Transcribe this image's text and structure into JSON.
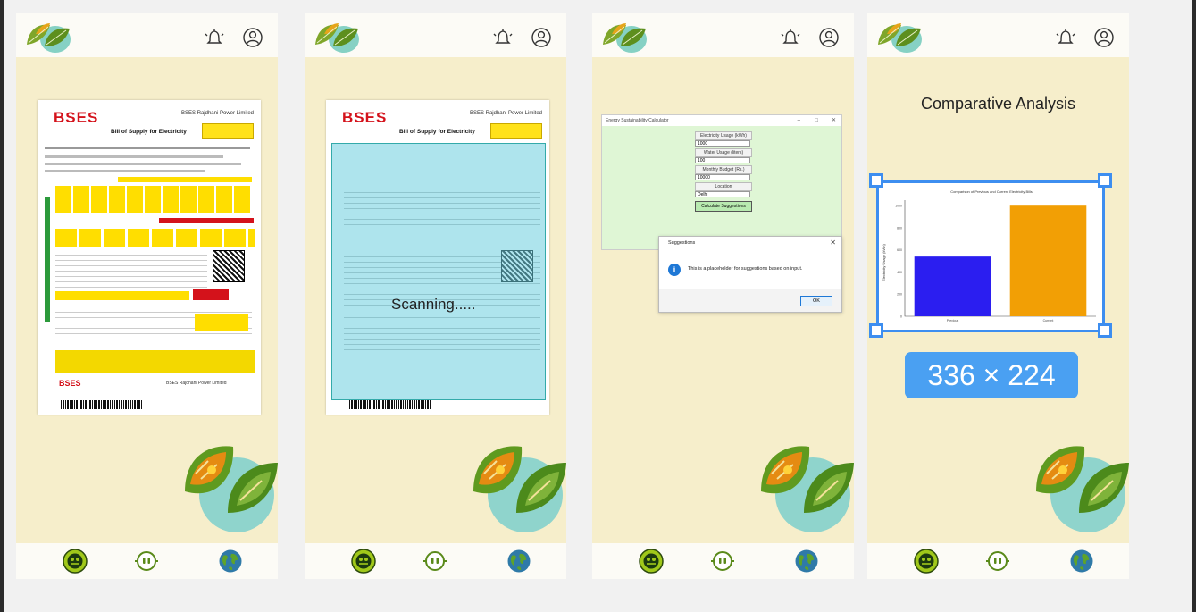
{
  "top_fragments": [
    "...",
    "...",
    "...",
    "..."
  ],
  "bill": {
    "brand": "BSES",
    "company": "BSES Rajdhani Power Limited",
    "title": "Bill of Supply for Electricity",
    "footer_brand": "BSES",
    "footer_company": "BSES Rajdhani Power Limited"
  },
  "scan": {
    "status": "Scanning....."
  },
  "calculator": {
    "window_title": "Energy Sustainability Calculator",
    "controls": [
      "–",
      "□",
      "✕"
    ],
    "fields": [
      {
        "label": "Electricity Usage (kWh)",
        "value": "1000"
      },
      {
        "label": "Water Usage (liters)",
        "value": "100"
      },
      {
        "label": "Monthly Budget (Rs.)",
        "value": "10000"
      },
      {
        "label": "Location",
        "value": "Delhi"
      }
    ],
    "button": "Calculate Suggestions"
  },
  "dialog": {
    "title": "Suggestions",
    "close": "✕",
    "message": "This is a placeholder for suggestions based on input.",
    "ok": "OK"
  },
  "analysis": {
    "title": "Comparative Analysis",
    "dimensions": "336 × 224"
  },
  "chart_data": {
    "type": "bar",
    "title": "Comparison of Previous and Current Electricity Bills",
    "categories": [
      "Previous",
      "Current"
    ],
    "values": [
      540,
      1000
    ],
    "ylabel": "Electricity Usage (kWh)",
    "ylim": [
      0,
      1050
    ],
    "colors": [
      "#2b1ef0",
      "#f29f05"
    ]
  },
  "colors": {
    "phone_bg": "#f6eecb",
    "bar_white": "#fcfbf6",
    "accent_blue": "#3d8ef0",
    "brand_red": "#d4121b"
  }
}
